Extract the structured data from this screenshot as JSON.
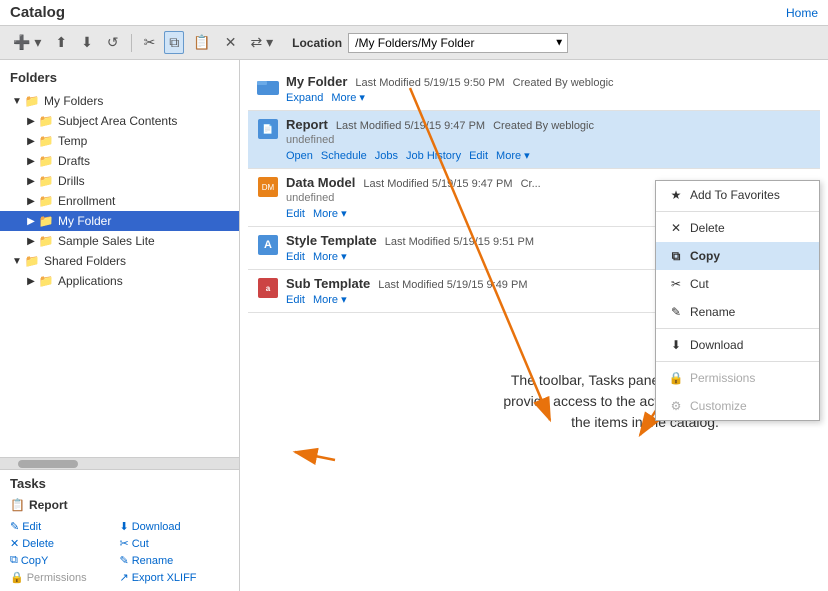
{
  "header": {
    "title": "Catalog",
    "home_label": "Home"
  },
  "toolbar": {
    "location_label": "Location",
    "location_value": "/My Folders/My Folder"
  },
  "sidebar": {
    "folders_title": "Folders",
    "tree": [
      {
        "id": "my-folders",
        "label": "My Folders",
        "level": 1,
        "expanded": true,
        "type": "folder"
      },
      {
        "id": "subject-area",
        "label": "Subject Area Contents",
        "level": 2,
        "expanded": false,
        "type": "folder"
      },
      {
        "id": "temp",
        "label": "Temp",
        "level": 2,
        "expanded": false,
        "type": "folder"
      },
      {
        "id": "drafts",
        "label": "Drafts",
        "level": 2,
        "expanded": false,
        "type": "folder"
      },
      {
        "id": "drills",
        "label": "Drills",
        "level": 2,
        "expanded": false,
        "type": "folder"
      },
      {
        "id": "enrollment",
        "label": "Enrollment",
        "level": 2,
        "expanded": false,
        "type": "folder"
      },
      {
        "id": "my-folder",
        "label": "My Folder",
        "level": 2,
        "expanded": false,
        "type": "folder",
        "selected": true
      },
      {
        "id": "sample-sales",
        "label": "Sample Sales Lite",
        "level": 2,
        "expanded": false,
        "type": "folder"
      },
      {
        "id": "shared-folders",
        "label": "Shared Folders",
        "level": 1,
        "expanded": true,
        "type": "folder"
      },
      {
        "id": "applications",
        "label": "Applications",
        "level": 2,
        "expanded": false,
        "type": "folder"
      }
    ],
    "tasks_title": "Tasks",
    "task_item_icon": "📋",
    "task_item_label": "Report",
    "task_links": [
      {
        "id": "edit",
        "label": "Edit",
        "icon": "✎",
        "disabled": false
      },
      {
        "id": "download",
        "label": "Download",
        "icon": "⬇",
        "disabled": false
      },
      {
        "id": "delete",
        "label": "Delete",
        "icon": "✕",
        "disabled": false
      },
      {
        "id": "cut",
        "label": "Cut",
        "icon": "✂",
        "disabled": false
      },
      {
        "id": "copy",
        "label": "CopY",
        "icon": "⧉",
        "disabled": false
      },
      {
        "id": "rename",
        "label": "Rename",
        "icon": "✎",
        "disabled": false
      },
      {
        "id": "permissions",
        "label": "Permissions",
        "icon": "🔒",
        "disabled": true
      },
      {
        "id": "export",
        "label": "Export XLIFF",
        "icon": "↗",
        "disabled": false
      }
    ]
  },
  "content": {
    "folder_name": "My Folder",
    "folder_modified": "Last Modified 5/19/15 9:50 PM",
    "folder_created": "Created By weblogic",
    "folder_actions": [
      "Expand",
      "More"
    ],
    "items": [
      {
        "id": "report",
        "name": "Report",
        "type": "report",
        "modified": "Last Modified 5/19/15 9:47 PM",
        "created": "Created By weblogic",
        "subname": "undefined",
        "actions": [
          "Open",
          "Schedule",
          "Jobs",
          "Job History",
          "Edit",
          "More"
        ],
        "highlighted": true
      },
      {
        "id": "data-model",
        "name": "Data Model",
        "type": "datamodel",
        "modified": "Last Modified 5/19/15 9:47 PM",
        "created": "Cr...",
        "subname": "undefined",
        "actions": [
          "Edit",
          "More"
        ],
        "highlighted": false
      },
      {
        "id": "style-template",
        "name": "Style Template",
        "type": "style",
        "modified": "Last Modified 5/19/15 9:51 PM",
        "created": "",
        "subname": "",
        "actions": [
          "Edit",
          "More"
        ],
        "highlighted": false
      },
      {
        "id": "sub-template",
        "name": "Sub Template",
        "type": "sub",
        "modified": "Last Modified 5/19/15 9:49 PM",
        "created": "",
        "subname": "",
        "actions": [
          "Edit",
          "More"
        ],
        "highlighted": false
      }
    ]
  },
  "context_menu": {
    "items": [
      {
        "id": "add-favorites",
        "label": "Add To Favorites",
        "icon": "★",
        "disabled": false
      },
      {
        "id": "delete",
        "label": "Delete",
        "icon": "✕",
        "disabled": false
      },
      {
        "id": "copy",
        "label": "Copy",
        "icon": "⧉",
        "disabled": false,
        "active": true
      },
      {
        "id": "cut",
        "label": "Cut",
        "icon": "✂",
        "disabled": false
      },
      {
        "id": "rename",
        "label": "Rename",
        "icon": "✎",
        "disabled": false
      },
      {
        "id": "download",
        "label": "Download",
        "icon": "⬇",
        "disabled": false
      },
      {
        "id": "permissions",
        "label": "Permissions",
        "icon": "🔒",
        "disabled": true
      },
      {
        "id": "customize",
        "label": "Customize",
        "icon": "⚙",
        "disabled": true
      }
    ]
  },
  "annotation": {
    "text": "The toolbar, Tasks pane and\nMore menu all provide access\nto the actions you can take on\nthe items in the catalog."
  }
}
